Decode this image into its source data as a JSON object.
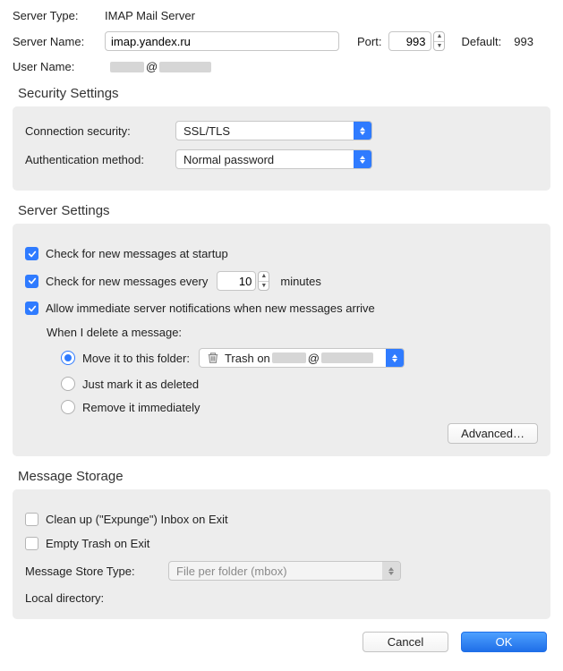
{
  "top": {
    "server_type_label": "Server Type:",
    "server_type_value": "IMAP Mail Server",
    "server_name_label": "Server Name:",
    "server_name_value": "imap.yandex.ru",
    "port_label": "Port:",
    "port_value": "993",
    "default_label": "Default:",
    "default_value": "993",
    "user_name_label": "User Name:",
    "user_name_value": ""
  },
  "security": {
    "title": "Security Settings",
    "conn_label": "Connection security:",
    "conn_value": "SSL/TLS",
    "auth_label": "Authentication method:",
    "auth_value": "Normal password"
  },
  "server": {
    "title": "Server Settings",
    "chk_startup_label": "Check for new messages at startup",
    "chk_startup_checked": true,
    "chk_every_label": "Check for new messages every",
    "chk_every_checked": true,
    "interval_value": "10",
    "minutes_label": "minutes",
    "chk_push_label": "Allow immediate server notifications when new messages arrive",
    "chk_push_checked": true,
    "delete_title": "When I delete a message:",
    "radio_move_label": "Move it to this folder:",
    "radio_mark_label": "Just mark it as deleted",
    "radio_remove_label": "Remove it immediately",
    "radio_selected": "move",
    "trash_prefix": "Trash on ",
    "trash_at": "@",
    "advanced_label": "Advanced…"
  },
  "storage": {
    "title": "Message Storage",
    "chk_expunge_label": "Clean up (\"Expunge\") Inbox on Exit",
    "chk_expunge_checked": false,
    "chk_empty_label": "Empty Trash on Exit",
    "chk_empty_checked": false,
    "store_type_label": "Message Store Type:",
    "store_type_value": "File per folder (mbox)",
    "local_dir_label": "Local directory:"
  },
  "footer": {
    "cancel": "Cancel",
    "ok": "OK"
  }
}
